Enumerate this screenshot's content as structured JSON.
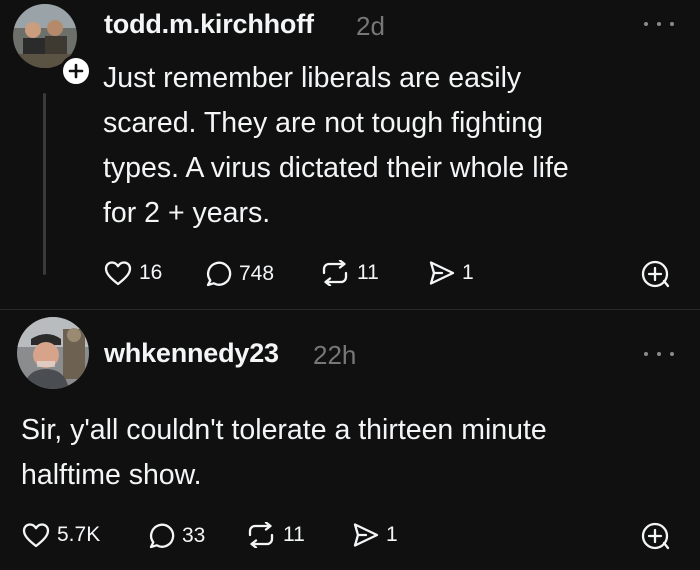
{
  "posts": [
    {
      "username": "todd.m.kirchhoff",
      "timestamp": "2d",
      "text": "Just remember liberals are easily\nscared. They are not tough fighting\ntypes. A virus dictated their whole life\nfor 2 + years.",
      "likes": "16",
      "replies": "748",
      "reposts": "11",
      "shares": "1"
    },
    {
      "username": "whkennedy23",
      "timestamp": "22h",
      "text": "Sir, y'all couldn't tolerate a thirteen minute\nhalftime show.",
      "likes": "5.7K",
      "replies": "33",
      "reposts": "11",
      "shares": "1"
    }
  ],
  "icons": {
    "like": "heart-icon",
    "reply": "speech-bubble-icon",
    "repost": "repost-arrows-icon",
    "share": "send-icon",
    "more": "more-options-icon",
    "follow": "plus-icon",
    "add": "add-circle-icon"
  },
  "colors": {
    "background": "#101010",
    "text": "#f3f5f7",
    "muted": "#777777"
  }
}
